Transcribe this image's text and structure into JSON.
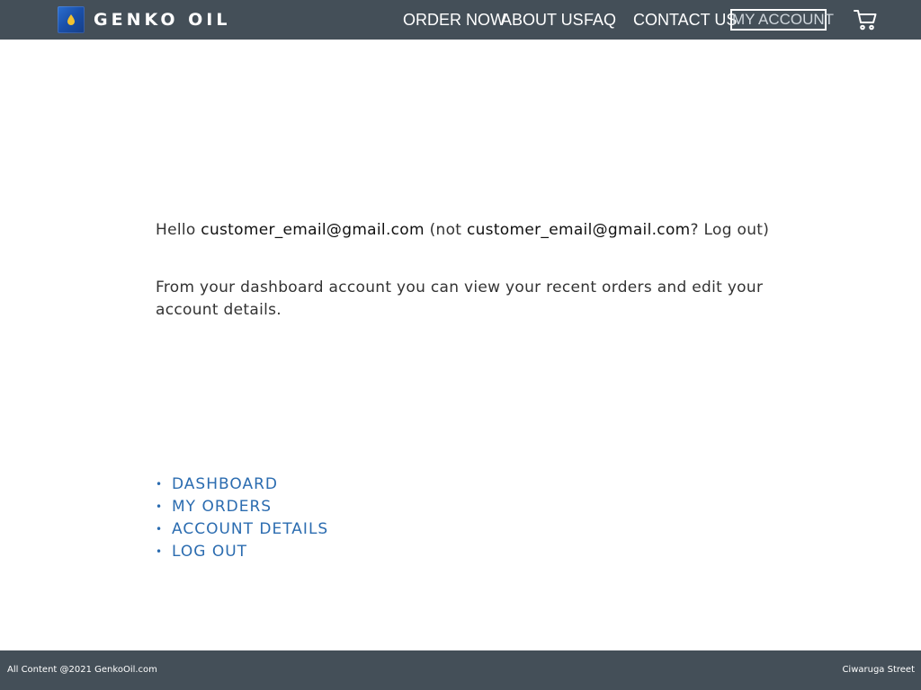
{
  "header": {
    "logo_text": "GENKO OIL",
    "logo_icon": "oil-drop-icon",
    "nav": {
      "order_now": "ORDER NOW",
      "about_us": "ABOUT US",
      "faq": "FAQ",
      "contact_us": "CONTACT US",
      "my_account": "MY ACCOUNT"
    },
    "cart_icon": "shopping-cart-icon"
  },
  "main": {
    "greeting": {
      "hello": "Hello ",
      "email": "customer_email@gmail.com",
      "not_open": " (not ",
      "email_again": "customer_email@gmail.com",
      "question": "? ",
      "logout": "Log out",
      "close": ")"
    },
    "intro": "From your dashboard account you can view your recent orders and edit your account details."
  },
  "account_nav": {
    "items": [
      {
        "bullet": "•",
        "label": "DASHBOARD"
      },
      {
        "bullet": "•",
        "label": "MY ORDERS"
      },
      {
        "bullet": "•",
        "label": "ACCOUNT DETAILS"
      },
      {
        "bullet": "•",
        "label": "LOG OUT"
      }
    ]
  },
  "footer": {
    "left": "All Content @2021 GenkoOil.com",
    "right": "Ciwaruga Street"
  },
  "colors": {
    "header_bg": "#444f58",
    "link_blue": "#2b6cb0",
    "logo_blue": "#1a4fa8",
    "drop_yellow": "#f2c230"
  }
}
